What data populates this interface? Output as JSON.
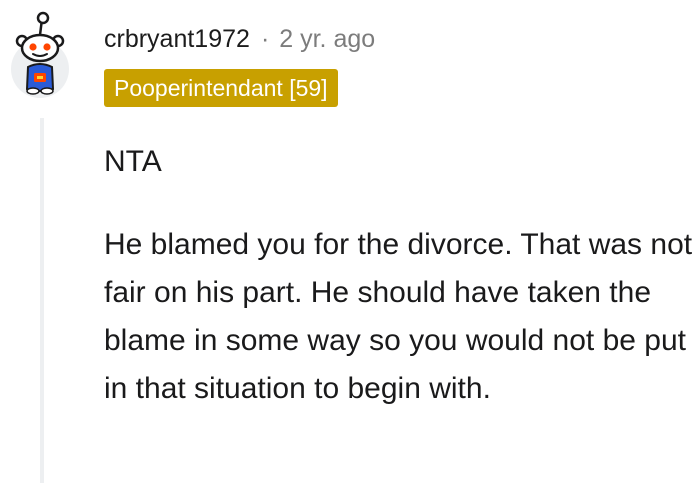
{
  "comment": {
    "author": "crbryant1972",
    "separator": "·",
    "time": "2 yr. ago",
    "flair": "Pooperintendant [59]",
    "paragraphs": [
      "NTA",
      "He blamed you for the divorce. That was not fair on his part. He should have taken the blame in some way so you would not be put in that situation to begin with."
    ]
  },
  "colors": {
    "flair_background": "#c8a000",
    "flair_text": "#ffffff",
    "avatar_accent": "#ff4500",
    "avatar_shirt": "#2a5bd7",
    "thread_line": "#edeff1",
    "muted_text": "#7c7c7c"
  },
  "icons": {
    "avatar": "snoo-avatar-icon"
  }
}
